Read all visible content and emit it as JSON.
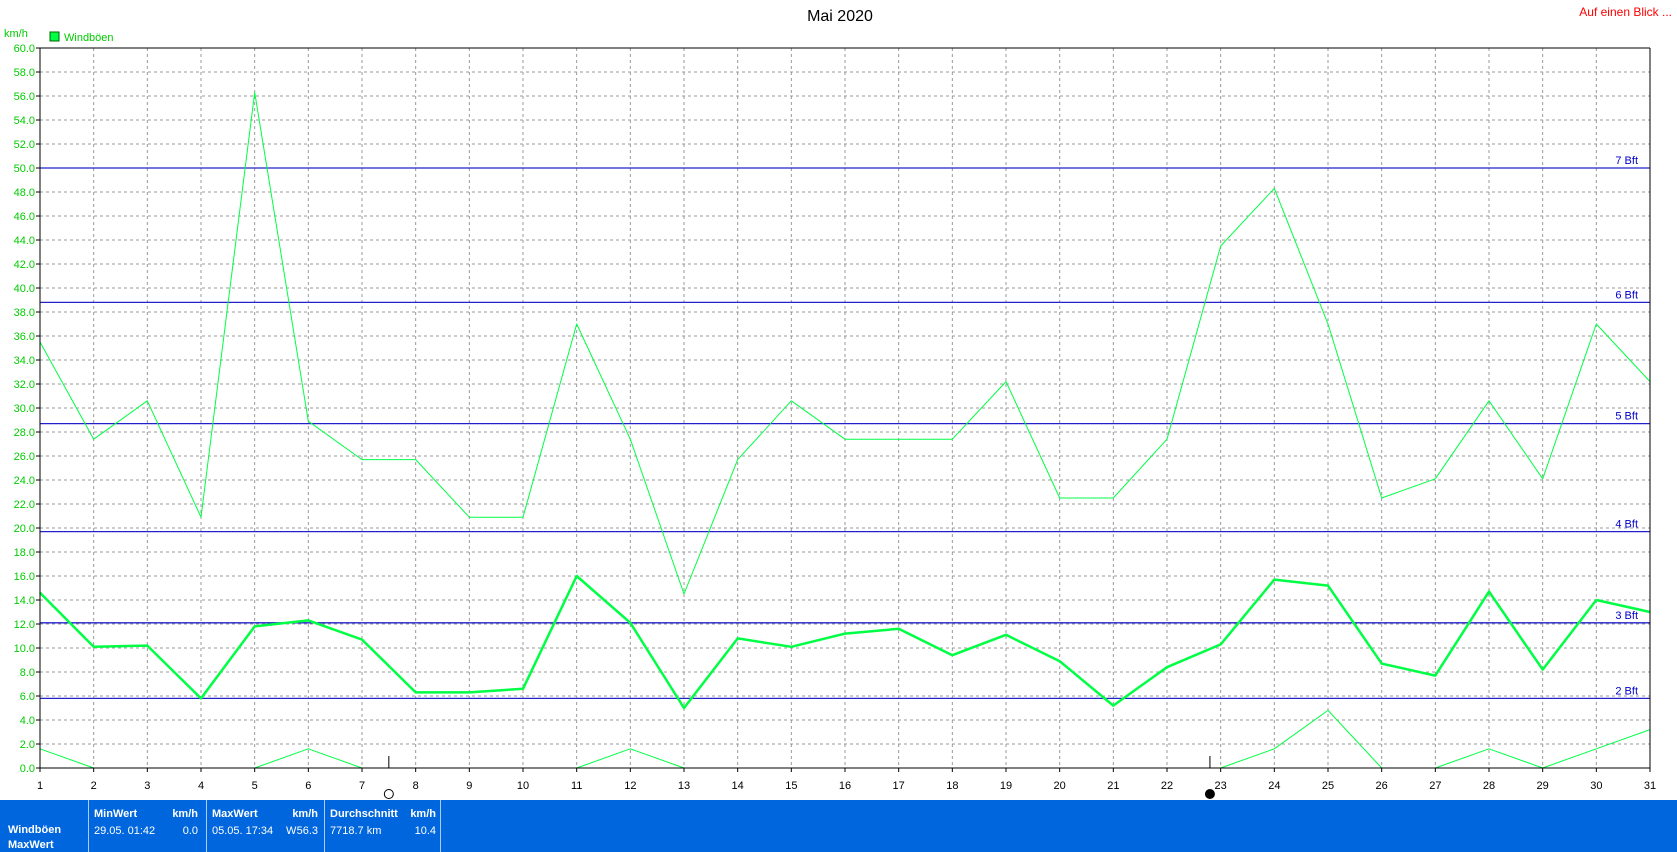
{
  "header": {
    "title": "Mai 2020",
    "overview_link": "Auf einen Blick ..."
  },
  "legend": {
    "label": "Windböen",
    "color": "#00ff44"
  },
  "chart_data": {
    "type": "line",
    "title": "Mai 2020",
    "ylabel": "km/h",
    "xlabel": "",
    "ylim": [
      0,
      60
    ],
    "xlim": [
      1,
      31
    ],
    "y_ticks": [
      "0.0",
      "2.0",
      "4.0",
      "6.0",
      "8.0",
      "10.0",
      "12.0",
      "14.0",
      "16.0",
      "18.0",
      "20.0",
      "22.0",
      "24.0",
      "26.0",
      "28.0",
      "30.0",
      "32.0",
      "34.0",
      "36.0",
      "38.0",
      "40.0",
      "42.0",
      "44.0",
      "46.0",
      "48.0",
      "50.0",
      "52.0",
      "54.0",
      "56.0",
      "58.0",
      "60.0"
    ],
    "x_ticks": [
      "1",
      "2",
      "3",
      "4",
      "5",
      "6",
      "7",
      "8",
      "9",
      "10",
      "11",
      "12",
      "13",
      "14",
      "15",
      "16",
      "17",
      "18",
      "19",
      "20",
      "21",
      "22",
      "23",
      "24",
      "25",
      "26",
      "27",
      "28",
      "29",
      "30",
      "31"
    ],
    "grid": true,
    "legend_position": "top-left",
    "series": [
      {
        "name": "Windböen",
        "role": "max",
        "color": "#00ff44",
        "stroke": 1,
        "x": [
          1,
          2,
          3,
          4,
          5,
          6,
          7,
          8,
          9,
          10,
          11,
          12,
          13,
          14,
          15,
          16,
          17,
          18,
          19,
          20,
          21,
          22,
          23,
          24,
          25,
          26,
          27,
          28,
          29,
          30,
          31
        ],
        "values": [
          35.5,
          27.4,
          30.6,
          20.9,
          56.3,
          28.9,
          25.7,
          25.7,
          20.9,
          20.9,
          37.0,
          27.4,
          14.5,
          25.7,
          30.6,
          27.4,
          27.4,
          27.4,
          32.2,
          22.5,
          22.5,
          27.4,
          43.5,
          48.3,
          37.0,
          22.5,
          24.1,
          30.6,
          24.1,
          37.0,
          32.2
        ]
      },
      {
        "name": "Windböen",
        "role": "avg",
        "color": "#00ff44",
        "stroke": 2.5,
        "x": [
          1,
          2,
          3,
          4,
          5,
          6,
          7,
          8,
          9,
          10,
          11,
          12,
          13,
          14,
          15,
          16,
          17,
          18,
          19,
          20,
          21,
          22,
          23,
          24,
          25,
          26,
          27,
          28,
          29,
          30,
          31
        ],
        "values": [
          14.6,
          10.1,
          10.2,
          5.8,
          11.8,
          12.3,
          10.7,
          6.3,
          6.3,
          6.6,
          16.0,
          12.1,
          5.0,
          10.8,
          10.1,
          11.2,
          11.6,
          9.4,
          11.1,
          8.9,
          5.2,
          8.4,
          10.3,
          15.7,
          15.2,
          8.7,
          7.7,
          14.7,
          8.2,
          14.0,
          13.0
        ]
      },
      {
        "name": "Windböen",
        "role": "min",
        "color": "#00ff44",
        "stroke": 1,
        "x": [
          1,
          2,
          3,
          4,
          5,
          6,
          7,
          8,
          9,
          10,
          11,
          12,
          13,
          14,
          15,
          16,
          17,
          18,
          19,
          20,
          21,
          22,
          23,
          24,
          25,
          26,
          27,
          28,
          29,
          30,
          31
        ],
        "values": [
          1.6,
          0.0,
          null,
          null,
          0.0,
          1.6,
          0.0,
          null,
          null,
          null,
          0.0,
          1.6,
          0.0,
          null,
          null,
          null,
          null,
          null,
          null,
          null,
          null,
          null,
          0.0,
          1.6,
          4.8,
          0.0,
          0.0,
          1.6,
          0.0,
          1.6,
          3.2
        ]
      }
    ],
    "reference_lines": [
      {
        "label": "2 Bft",
        "value": 5.8
      },
      {
        "label": "3 Bft",
        "value": 12.1
      },
      {
        "label": "4 Bft",
        "value": 19.7
      },
      {
        "label": "5 Bft",
        "value": 28.7
      },
      {
        "label": "6 Bft",
        "value": 38.8
      },
      {
        "label": "7 Bft",
        "value": 50.0
      }
    ],
    "moon_phases": [
      {
        "day": 7.5,
        "phase": "full-moon"
      },
      {
        "day": 22.8,
        "phase": "new-moon"
      }
    ]
  },
  "footer": {
    "row_labels": [
      "Windböen",
      "MaxWert"
    ],
    "min": {
      "label": "MinWert",
      "unit": "km/h",
      "date": "29.05.  01:42",
      "value": "0.0"
    },
    "max": {
      "label": "MaxWert",
      "unit": "km/h",
      "date": "05.05.  17:34",
      "dir": "W",
      "value": "56.3"
    },
    "avg": {
      "label": "Durchschnitt",
      "unit": "km/h",
      "total": "7718.7 km",
      "value": "10.4"
    }
  }
}
